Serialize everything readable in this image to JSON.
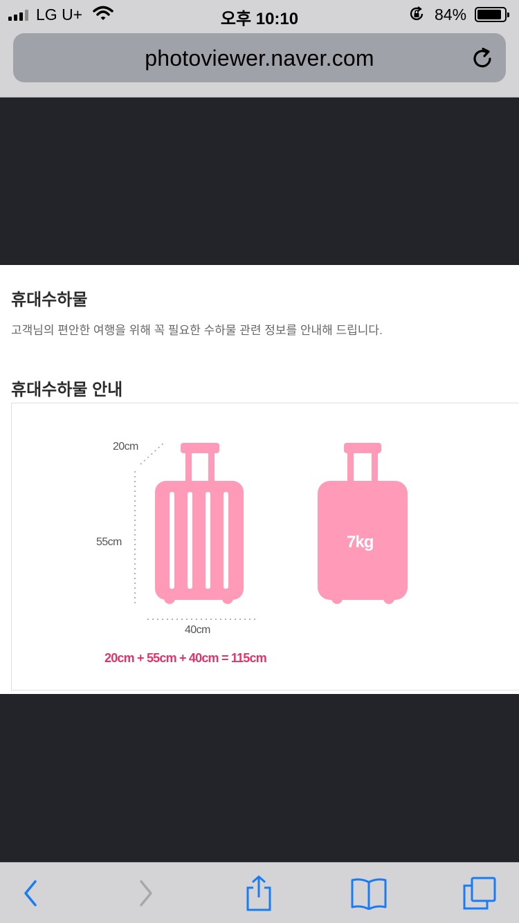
{
  "status_bar": {
    "carrier": "LG U+",
    "time": "오후 10:10",
    "battery_percent": "84%",
    "battery_level": 0.84,
    "icons": [
      "signal-icon",
      "wifi-icon",
      "orientation-lock-icon",
      "battery-icon"
    ]
  },
  "address_bar": {
    "url": "photoviewer.naver.com",
    "reload_icon": "reload-icon"
  },
  "content": {
    "section_title": "휴대수하물",
    "section_description": "고객님의 편안한 여행을 위해 꼭 필요한 수하물 관련 정보를 안내해 드립니다.",
    "guide_title": "휴대수하물 안내",
    "guide": {
      "depth_label": "20cm",
      "height_label": "55cm",
      "width_label": "40cm",
      "weight_label": "7kg",
      "formula": "20cm + 55cm + 40cm = 115cm",
      "accent_color": "#ff9ab8",
      "formula_color": "#e2336b"
    }
  },
  "toolbar": {
    "buttons": [
      "back-icon",
      "forward-icon",
      "share-icon",
      "bookmarks-icon",
      "tabs-icon"
    ],
    "accent_color": "#1a7cf5"
  }
}
